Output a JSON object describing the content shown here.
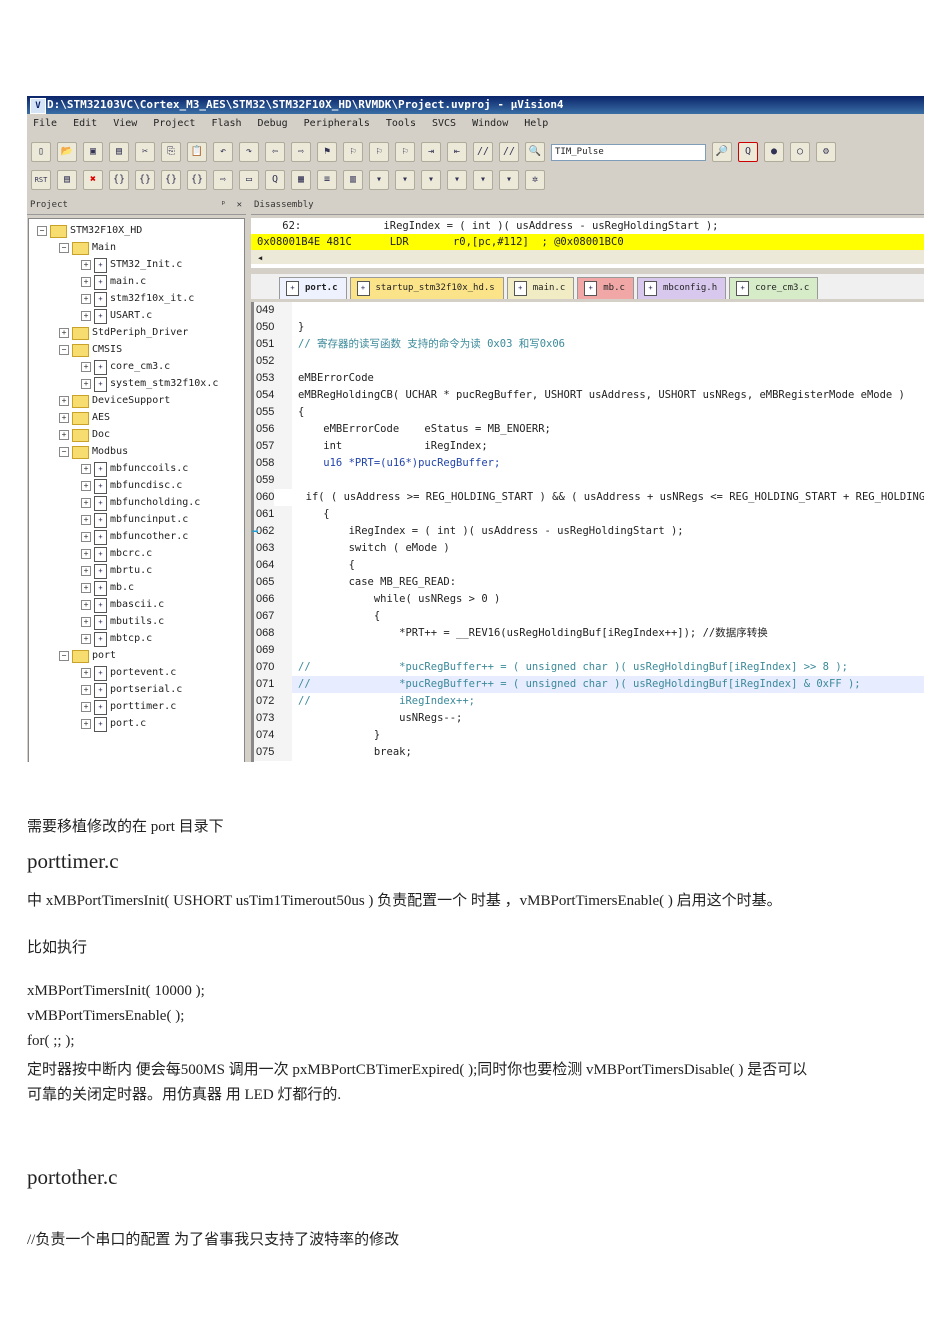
{
  "window": {
    "title": "D:\\STM32103VC\\Cortex_M3_AES\\STM32\\STM32F10X_HD\\RVMDK\\Project.uvproj - µVision4",
    "icon": "uv-icon"
  },
  "menu": [
    "File",
    "Edit",
    "View",
    "Project",
    "Flash",
    "Debug",
    "Peripherals",
    "Tools",
    "SVCS",
    "Window",
    "Help"
  ],
  "toolbar": {
    "find_combo": "TIM_Pulse",
    "rst_label": "RST"
  },
  "panels": {
    "project": "Project",
    "pin": "ᵖ",
    "close": "✕",
    "disassembly": "Disassembly"
  },
  "tree": [
    {
      "label": "STM32F10X_HD",
      "lvl": 0,
      "type": "root",
      "pm": "−"
    },
    {
      "label": "Main",
      "lvl": 1,
      "type": "folder",
      "pm": "−"
    },
    {
      "label": "STM32_Init.c",
      "lvl": 2,
      "type": "file",
      "pm": "+"
    },
    {
      "label": "main.c",
      "lvl": 2,
      "type": "file",
      "pm": "+"
    },
    {
      "label": "stm32f10x_it.c",
      "lvl": 2,
      "type": "file",
      "pm": "+"
    },
    {
      "label": "USART.c",
      "lvl": 2,
      "type": "file",
      "pm": "+"
    },
    {
      "label": "StdPeriph_Driver",
      "lvl": 1,
      "type": "folder",
      "pm": "+"
    },
    {
      "label": "CMSIS",
      "lvl": 1,
      "type": "folder",
      "pm": "−"
    },
    {
      "label": "core_cm3.c",
      "lvl": 2,
      "type": "file",
      "pm": "+"
    },
    {
      "label": "system_stm32f10x.c",
      "lvl": 2,
      "type": "file",
      "pm": "+"
    },
    {
      "label": "DeviceSupport",
      "lvl": 1,
      "type": "folder",
      "pm": "+"
    },
    {
      "label": "AES",
      "lvl": 1,
      "type": "folder",
      "pm": "+"
    },
    {
      "label": "Doc",
      "lvl": 1,
      "type": "folder",
      "pm": "+"
    },
    {
      "label": "Modbus",
      "lvl": 1,
      "type": "folder",
      "pm": "−"
    },
    {
      "label": "mbfunccoils.c",
      "lvl": 2,
      "type": "file",
      "pm": "+"
    },
    {
      "label": "mbfuncdisc.c",
      "lvl": 2,
      "type": "file",
      "pm": "+"
    },
    {
      "label": "mbfuncholding.c",
      "lvl": 2,
      "type": "file",
      "pm": "+"
    },
    {
      "label": "mbfuncinput.c",
      "lvl": 2,
      "type": "file",
      "pm": "+"
    },
    {
      "label": "mbfuncother.c",
      "lvl": 2,
      "type": "file",
      "pm": "+"
    },
    {
      "label": "mbcrc.c",
      "lvl": 2,
      "type": "file",
      "pm": "+"
    },
    {
      "label": "mbrtu.c",
      "lvl": 2,
      "type": "file",
      "pm": "+"
    },
    {
      "label": "mb.c",
      "lvl": 2,
      "type": "file",
      "pm": "+"
    },
    {
      "label": "mbascii.c",
      "lvl": 2,
      "type": "file",
      "pm": "+"
    },
    {
      "label": "mbutils.c",
      "lvl": 2,
      "type": "file",
      "pm": "+"
    },
    {
      "label": "mbtcp.c",
      "lvl": 2,
      "type": "file",
      "pm": "+"
    },
    {
      "label": "port",
      "lvl": 1,
      "type": "folder",
      "pm": "−"
    },
    {
      "label": "portevent.c",
      "lvl": 2,
      "type": "file",
      "pm": "+"
    },
    {
      "label": "portserial.c",
      "lvl": 2,
      "type": "file",
      "pm": "+"
    },
    {
      "label": "porttimer.c",
      "lvl": 2,
      "type": "file",
      "pm": "+"
    },
    {
      "label": "port.c",
      "lvl": 2,
      "type": "file",
      "pm": "+"
    }
  ],
  "disassembly": [
    "    62:             iRegIndex = ( int )( usAddress - usRegHoldingStart );",
    "0x08001B4E 481C      LDR       r0,[pc,#112]  ; @0x08001BC0"
  ],
  "tabs": [
    {
      "label": "port.c",
      "color": "#eef2ff"
    },
    {
      "label": "startup_stm32f10x_hd.s",
      "color": "#fbe38a"
    },
    {
      "label": "main.c",
      "color": "#f1ecc4"
    },
    {
      "label": "mb.c",
      "color": "#f2a7a7"
    },
    {
      "label": "mbconfig.h",
      "color": "#d8c8ee"
    },
    {
      "label": "core_cm3.c",
      "color": "#d6ecc8"
    }
  ],
  "code": [
    {
      "n": "049",
      "t": "",
      "k": ""
    },
    {
      "n": "050",
      "t": "}",
      "k": ""
    },
    {
      "n": "051",
      "t": "// 寄存器的读写函数 支持的命令为读 0x03 和写0x06",
      "k": "cm"
    },
    {
      "n": "052",
      "t": "",
      "k": ""
    },
    {
      "n": "053",
      "t": "eMBErrorCode",
      "k": ""
    },
    {
      "n": "054",
      "t": "eMBRegHoldingCB( UCHAR * pucRegBuffer, USHORT usAddress, USHORT usNRegs, eMBRegisterMode eMode )",
      "k": ""
    },
    {
      "n": "055",
      "t": "{",
      "k": ""
    },
    {
      "n": "056",
      "t": "    eMBErrorCode    eStatus = MB_ENOERR;",
      "k": ""
    },
    {
      "n": "057",
      "t": "    int             iRegIndex;",
      "k": ""
    },
    {
      "n": "058",
      "t": "    u16 *PRT=(u16*)pucRegBuffer;",
      "k": "kw"
    },
    {
      "n": "059",
      "t": "",
      "k": ""
    },
    {
      "n": "060",
      "t": "    if( ( usAddress >= REG_HOLDING_START ) && ( usAddress + usNRegs <= REG_HOLDING_START + REG_HOLDING_NREGS ) )",
      "k": ""
    },
    {
      "n": "061",
      "t": "    {",
      "k": ""
    },
    {
      "n": "062",
      "t": "        iRegIndex = ( int )( usAddress - usRegHoldingStart );",
      "k": "",
      "arrow": true
    },
    {
      "n": "063",
      "t": "        switch ( eMode )",
      "k": ""
    },
    {
      "n": "064",
      "t": "        {",
      "k": ""
    },
    {
      "n": "065",
      "t": "        case MB_REG_READ:",
      "k": ""
    },
    {
      "n": "066",
      "t": "            while( usNRegs > 0 )",
      "k": ""
    },
    {
      "n": "067",
      "t": "            {",
      "k": ""
    },
    {
      "n": "068",
      "t": "                *PRT++ = __REV16(usRegHoldingBuf[iRegIndex++]); //数据序转换",
      "k": ""
    },
    {
      "n": "069",
      "t": "",
      "k": ""
    },
    {
      "n": "070",
      "t": "//              *pucRegBuffer++ = ( unsigned char )( usRegHoldingBuf[iRegIndex] >> 8 );",
      "k": "cm"
    },
    {
      "n": "071",
      "t": "//              *pucRegBuffer++ = ( unsigned char )( usRegHoldingBuf[iRegIndex] & 0xFF );",
      "k": "cm",
      "hl": true
    },
    {
      "n": "072",
      "t": "//              iRegIndex++;",
      "k": "cm"
    },
    {
      "n": "073",
      "t": "                usNRegs--;",
      "k": ""
    },
    {
      "n": "074",
      "t": "            }",
      "k": ""
    },
    {
      "n": "075",
      "t": "            break;",
      "k": ""
    }
  ],
  "doc": {
    "p1": "需要移植修改的在  port  目录下",
    "h1": "porttimer.c",
    "p2": "中  xMBPortTimersInit( USHORT usTim1Timerout50us )  负责配置一个  时基  ，vMBPortTimersEnable(    )  启用这个时基。",
    "p3": "比如执行",
    "c1": "xMBPortTimersInit( 10000 );",
    "c2": "vMBPortTimersEnable( );",
    "c3": "for( ;; );",
    "p4": "定时器按中断内  便会每500MS 调用一次 pxMBPortCBTimerExpired(    );同时你也要检测 vMBPortTimersDisable( )  是否可以",
    "p5": "可靠的关闭定时器。用仿真器  用 LED 灯都行的.",
    "h2": "portother.c",
    "p6": "//负责一个串口的配置  为了省事我只支持了波特率的修改"
  }
}
